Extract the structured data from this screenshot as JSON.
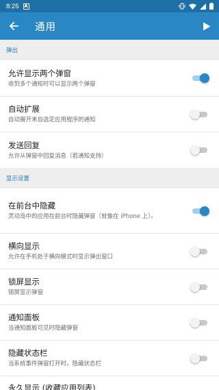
{
  "status_bar": {
    "time": "8:25",
    "notification_icon": "A",
    "icons": [
      "vibrate-icon",
      "wifi-icon",
      "signal-icon",
      "battery-icon"
    ]
  },
  "toolbar": {
    "title": "通用",
    "back_icon": "arrow-left",
    "play_icon": "play"
  },
  "colors": {
    "status_bar": "#1f6fa7",
    "toolbar": "#2a87c6",
    "accent": "#2a87c6",
    "section_bg": "#eeeeee"
  },
  "sections": [
    {
      "title": "弹出",
      "items": [
        {
          "title": "允许显示两个弹窗",
          "subtitle": "收到多个通知时可以显示两个弹窗",
          "enabled": true
        },
        {
          "title": "自动扩展",
          "subtitle": "自动展开来自选定应用程序的通知",
          "enabled": false
        },
        {
          "title": "发送回复",
          "subtitle": "允许从弹窗中回复消息（若通知支持）",
          "enabled": false
        }
      ]
    },
    {
      "title": "显示设置",
      "items": [
        {
          "title": "在前台中隐藏",
          "subtitle": "灵动岛中的应用在前台时隐藏弹窗（就像在 iPhone 上）。",
          "enabled": true
        },
        {
          "title": "横向显示",
          "subtitle": "允许在手机处于横向模式时显示弹出窗口",
          "enabled": false
        },
        {
          "title": "锁屏显示",
          "subtitle": "锁屏显示弹窗",
          "enabled": false
        },
        {
          "title": "通知面板",
          "subtitle": "当通知面板可见时隐藏弹窗",
          "enabled": false
        },
        {
          "title": "隐藏状态栏",
          "subtitle": "当系统事件弹窗打开时，隐藏状态栏",
          "enabled": false
        },
        {
          "title": "永久显示 (收藏应用列表)",
          "subtitle": ""
        }
      ]
    }
  ]
}
